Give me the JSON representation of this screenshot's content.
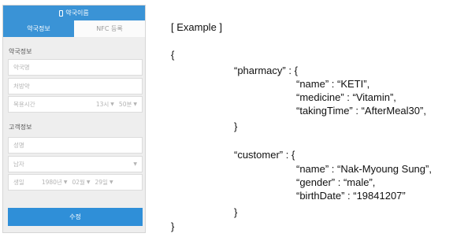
{
  "app": {
    "title": "약국이름"
  },
  "tabs": [
    {
      "label": "약국정보",
      "active": true
    },
    {
      "label": "NFC 등록",
      "active": false
    }
  ],
  "pharmacy_section": {
    "label": "약국정보",
    "name_placeholder": "약국명",
    "medicine_placeholder": "처방약",
    "time_label": "복용시간",
    "hour_value": "13시",
    "minute_value": "50분"
  },
  "customer_section": {
    "label": "고객정보",
    "name_placeholder": "성명",
    "gender_value": "남자",
    "birth_label": "생일",
    "year_value": "1980년",
    "month_value": "02월",
    "day_value": "29일"
  },
  "submit_label": "수정",
  "colors": {
    "accent": "#3a93d6",
    "button": "#2f8fd8"
  },
  "example": {
    "heading": "[ Example ]",
    "open_brace": "{",
    "pharmacy_key": "“pharmacy” : {",
    "pharmacy_name": "“name” : “KETI”,",
    "pharmacy_medicine": "“medicine” : “Vitamin”,",
    "pharmacy_taking_time": "“takingTime” : “AfterMeal30”,",
    "pharmacy_close": "}",
    "customer_key": "“customer” : {",
    "customer_name": "“name” : “Nak-Myoung Sung”,",
    "customer_gender": "“gender” : “male”,",
    "customer_birth": "“birthDate” : “19841207”",
    "customer_close": "}",
    "close_brace": "}"
  }
}
